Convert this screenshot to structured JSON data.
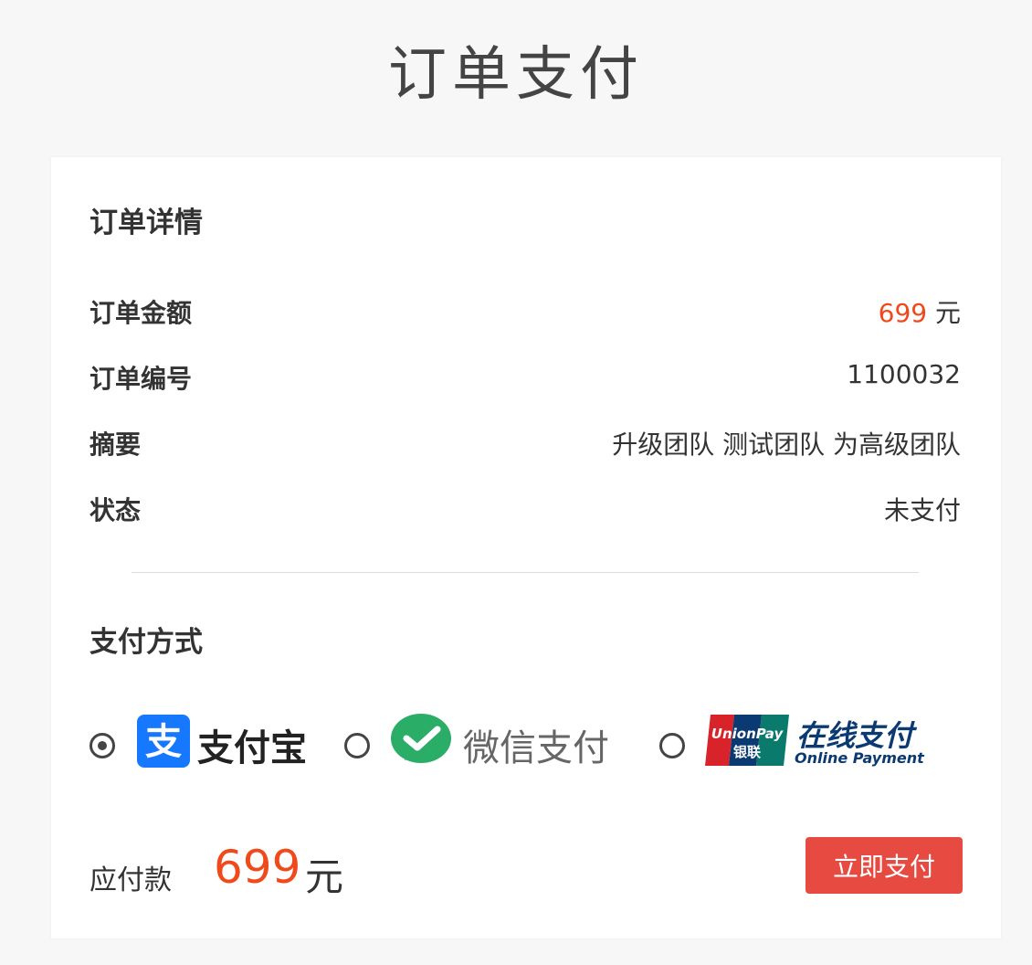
{
  "page": {
    "title": "订单支付"
  },
  "order": {
    "section_title": "订单详情",
    "amount_label": "订单金额",
    "amount_value": "699",
    "amount_unit": "元",
    "id_label": "订单编号",
    "id_value": "1100032",
    "summary_label": "摘要",
    "summary_value": "升级团队 测试团队 为高级团队",
    "status_label": "状态",
    "status_value": "未支付"
  },
  "payment": {
    "section_title": "支付方式",
    "selected": "alipay",
    "methods": [
      {
        "id": "alipay",
        "name": "支付宝",
        "icon": "alipay-icon",
        "brand_color": "#1677ff"
      },
      {
        "id": "wechat",
        "name": "微信支付",
        "icon": "wechat-pay-icon",
        "brand_color": "#2aae67"
      },
      {
        "id": "unionpay",
        "name": "在线支付",
        "subname": "Online Payment",
        "logo_text": [
          "UnionPay",
          "银联"
        ],
        "icon": "unionpay-icon",
        "brand_color": "#0b3a72"
      }
    ]
  },
  "footer": {
    "due_label": "应付款",
    "due_amount": "699",
    "due_unit": "元",
    "pay_button": "立即支付"
  },
  "colors": {
    "accent": "#f04a1c",
    "button": "#e64a40",
    "background": "#f7f7f7"
  }
}
